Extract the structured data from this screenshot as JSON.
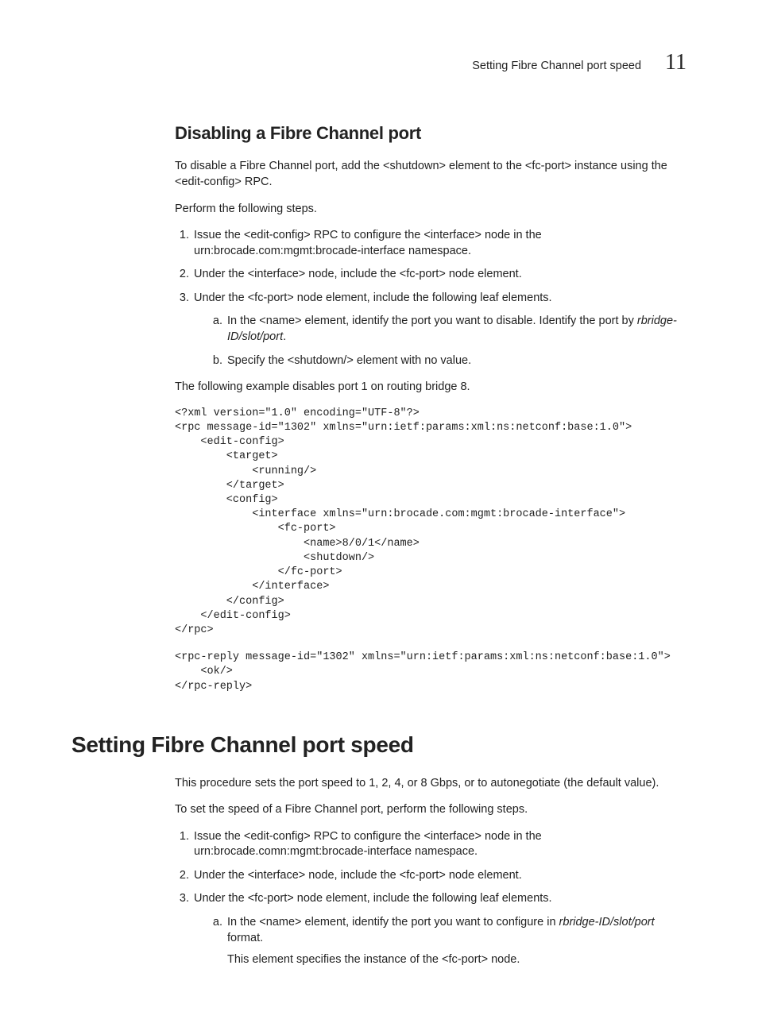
{
  "header": {
    "label": "Setting Fibre Channel port speed",
    "chapter": "11"
  },
  "section1": {
    "heading": "Disabling a Fibre Channel port",
    "intro": "To disable a Fibre Channel port, add the <shutdown> element to the <fc-port> instance using the <edit-config> RPC.",
    "perform": "Perform the following steps.",
    "step1": "Issue the <edit-config> RPC to configure the <interface> node in the urn:brocade.com:mgmt:brocade-interface namespace.",
    "step2": "Under the <interface> node, include the <fc-port> node element.",
    "step3": "Under the <fc-port> node element, include the following leaf elements.",
    "step3a_pre": "In the <name> element, identify the port you want to disable. Identify the port by ",
    "step3a_it": "rbridge-ID/slot/port",
    "step3a_post": ".",
    "step3b": "Specify the <shutdown/> element with no value.",
    "example_intro": "The following example disables port 1 on routing bridge 8.",
    "code1": "<?xml version=\"1.0\" encoding=\"UTF-8\"?>\n<rpc message-id=\"1302\" xmlns=\"urn:ietf:params:xml:ns:netconf:base:1.0\">\n    <edit-config>\n        <target>\n            <running/>\n        </target>\n        <config>\n            <interface xmlns=\"urn:brocade.com:mgmt:brocade-interface\">\n                <fc-port>\n                    <name>8/0/1</name>\n                    <shutdown/>\n                </fc-port>\n            </interface>\n        </config>\n    </edit-config>\n</rpc>",
    "code2": "<rpc-reply message-id=\"1302\" xmlns=\"urn:ietf:params:xml:ns:netconf:base:1.0\">\n    <ok/>\n</rpc-reply>"
  },
  "section2": {
    "heading": "Setting Fibre Channel port speed",
    "intro": "This procedure sets the port speed to 1, 2, 4, or 8 Gbps, or to autonegotiate (the default value).",
    "perform": "To set the speed of a Fibre Channel port, perform the following steps.",
    "step1": "Issue the <edit-config> RPC to configure the <interface> node in the urn:brocade.comn:mgmt:brocade-interface namespace.",
    "step2": "Under the <interface> node, include the <fc-port> node element.",
    "step3": "Under the <fc-port> node element, include the following leaf elements.",
    "step3a_pre": "In the <name> element, identify the port you want to configure in ",
    "step3a_it": "rbridge-ID/slot/port",
    "step3a_post": " format.",
    "step3a_note": "This element specifies the instance of the <fc-port> node."
  }
}
